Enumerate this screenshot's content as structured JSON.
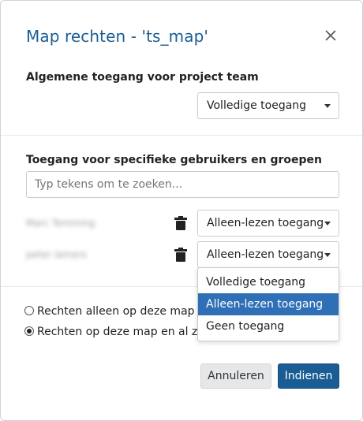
{
  "dialog": {
    "title": "Map rechten - 'ts_map'"
  },
  "general_access": {
    "label": "Algemene toegang voor project team",
    "selected": "Volledige toegang"
  },
  "specific_access": {
    "label": "Toegang voor specifieke gebruikers en groepen",
    "search_placeholder": "Typ tekens om te zoeken...",
    "users": [
      {
        "name": "Marc Temming",
        "access": "Alleen-lezen toegang"
      },
      {
        "name": "peter lamers",
        "access": "Alleen-lezen toegang"
      }
    ]
  },
  "dropdown_menu": {
    "options": [
      "Volledige toegang",
      "Alleen-lezen toegang",
      "Geen toegang"
    ],
    "highlighted_index": 1
  },
  "scope": {
    "options": [
      {
        "label": "Rechten alleen op deze map toepassen",
        "checked": false
      },
      {
        "label": "Rechten op deze map en al zijn submappen toepassen",
        "checked": true
      }
    ]
  },
  "footer": {
    "cancel_label": "Annuleren",
    "submit_label": "Indienen"
  },
  "colors": {
    "title": "#1a5d94",
    "primary_button": "#1a5d94",
    "menu_highlight": "#2f6fb5"
  },
  "icons": {
    "close": "close-icon",
    "trash": "trash-icon",
    "caret": "chevron-down-icon"
  }
}
